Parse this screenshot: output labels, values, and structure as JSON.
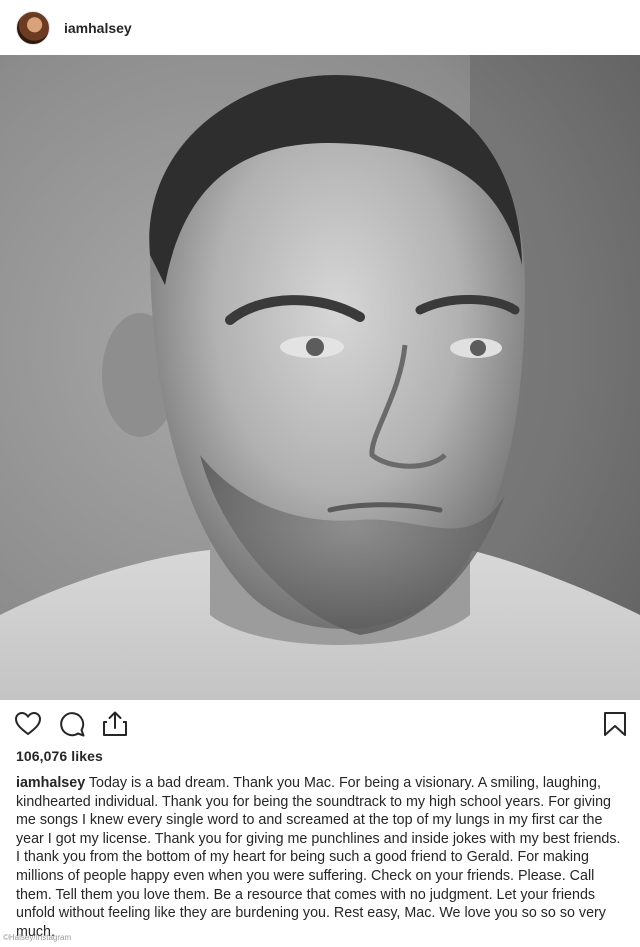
{
  "post": {
    "username": "iamhalsey",
    "likes": "106,076 likes",
    "caption": "Today is a bad dream. Thank you Mac. For being a visionary. A smiling, laughing, kindhearted individual. Thank you for being the soundtrack to my high school years. For giving me songs I knew every single word to and screamed at the top of my lungs in my first car the year I got my license. Thank you for giving me punchlines and inside jokes with my best friends. I thank you from the bottom of my heart for being such a good friend to Gerald. For making millions of people happy even when you were suffering. Check on your friends. Please. Call them. Tell them you love them. Be a resource that comes with no judgment. Let your friends unfold without feeling like they are burdening you. Rest easy, Mac. We love you so so so very much."
  },
  "photo_credit": "©Halsey/Instagram",
  "icons": {
    "like": "heart-outline-icon",
    "comment": "speech-bubble-icon",
    "share": "share-arrow-icon",
    "save": "bookmark-icon"
  },
  "photo": {
    "description_style": "black-and-white portrait"
  },
  "colors": {
    "text": "#262626",
    "background": "#ffffff",
    "credit": "#9a9a9a"
  }
}
